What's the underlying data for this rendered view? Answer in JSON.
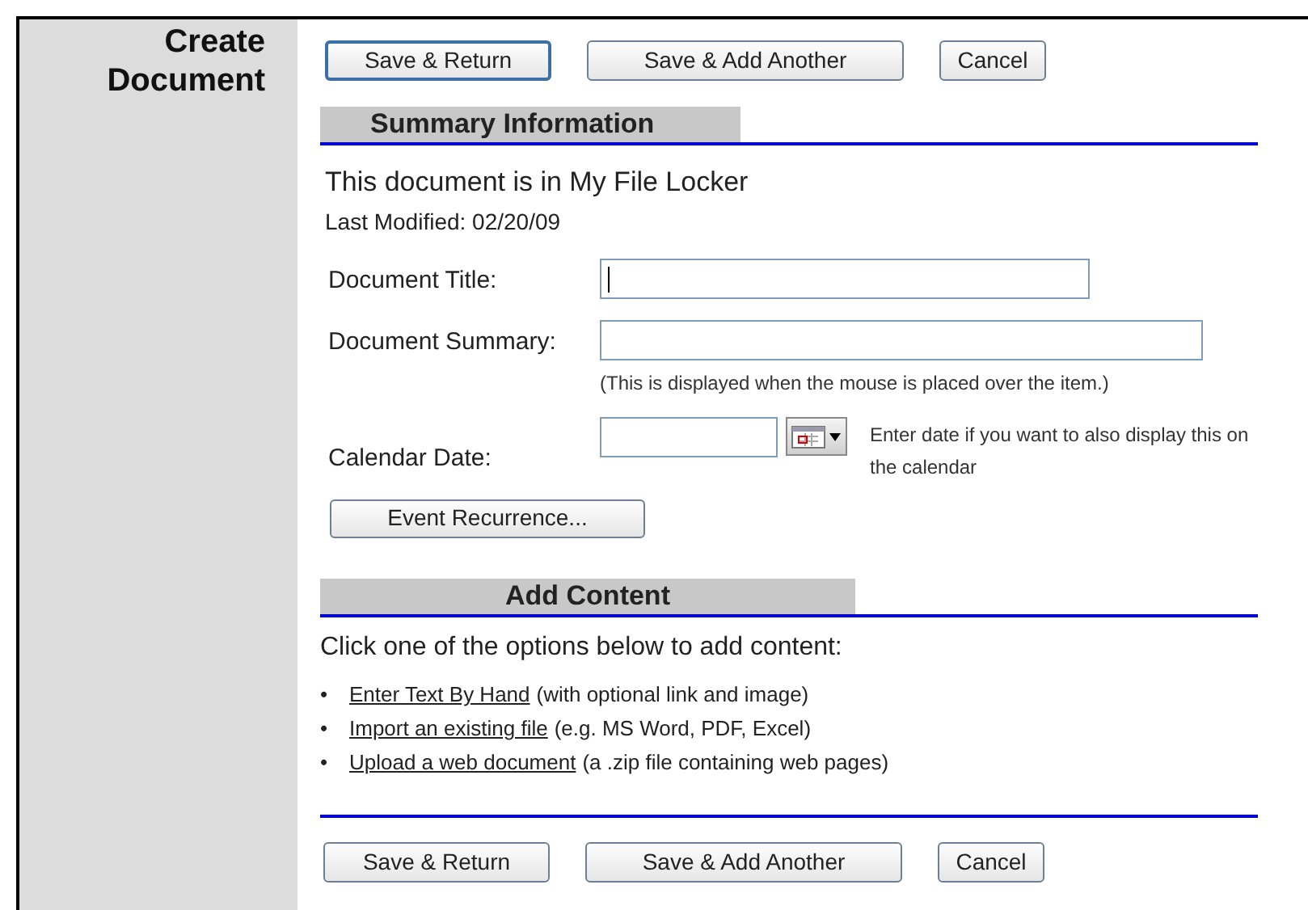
{
  "sidebar": {
    "title_lines": [
      "Create",
      "Document"
    ]
  },
  "top_buttons": [
    {
      "label": "Save & Return",
      "focused": true
    },
    {
      "label": "Save & Add Another",
      "focused": false
    },
    {
      "label": "Cancel",
      "focused": false
    }
  ],
  "summary_section": {
    "heading": "Summary Information",
    "location_text": "This document is in My File Locker",
    "last_modified": "Last Modified: 02/20/09",
    "fields": [
      {
        "kind": "text",
        "label": "Document Title:",
        "has_cursor": true
      },
      {
        "kind": "text-hint",
        "label": "Document Summary:",
        "has_cursor": false,
        "hint": "(This is displayed when the mouse is placed over the item.)"
      },
      {
        "kind": "date",
        "label": "Calendar Date:",
        "has_cursor": false,
        "hint": "Enter date if you want to also display this on the calendar"
      }
    ],
    "recurrence_button": "Event Recurrence..."
  },
  "content_section": {
    "heading": "Add Content",
    "intro": "Click one of the options below to add content:",
    "options": [
      {
        "bullet": "•",
        "link": "Enter Text By Hand",
        "note": "(with optional link and image)"
      },
      {
        "bullet": "•",
        "link": "Import an existing file",
        "note": "(e.g. MS Word, PDF, Excel)"
      },
      {
        "bullet": "•",
        "link": "Upload a web document",
        "note": "(a .zip file containing web pages)"
      }
    ]
  },
  "bottom_buttons": [
    {
      "label": "Save & Return",
      "focused": false
    },
    {
      "label": "Save & Add Another",
      "focused": false
    },
    {
      "label": "Cancel",
      "focused": false
    }
  ]
}
